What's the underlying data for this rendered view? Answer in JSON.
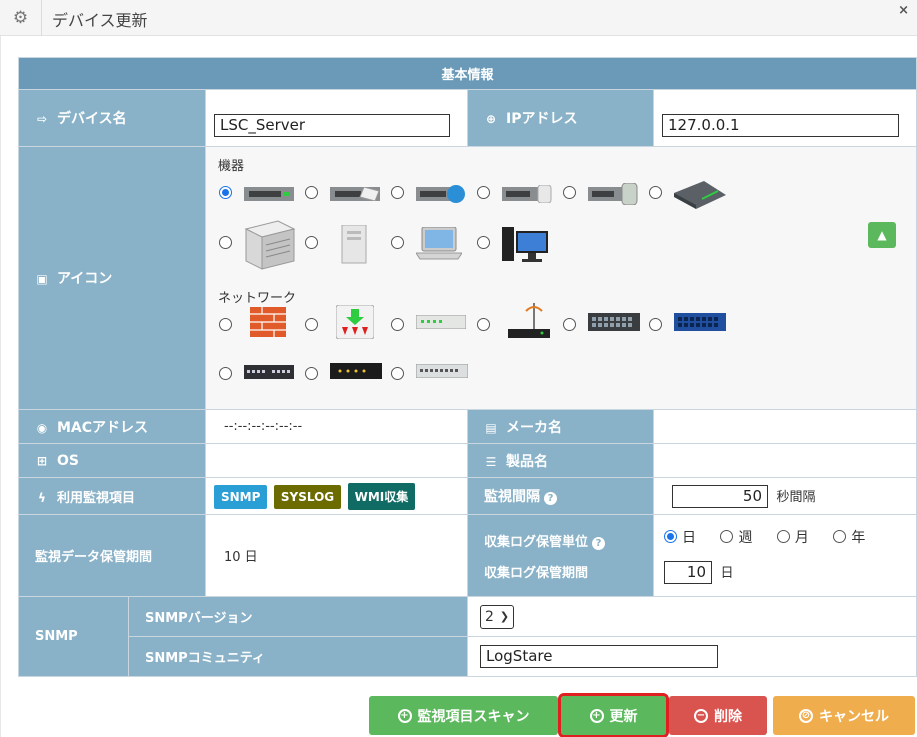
{
  "window": {
    "title": "デバイス更新",
    "close": "×"
  },
  "section_title": "基本情報",
  "device_name": {
    "label": "デバイス名",
    "value": "LSC_Server"
  },
  "ip": {
    "label": "IPアドレス",
    "value": "127.0.0.1"
  },
  "icon": {
    "label": "アイコン",
    "group_equipment": "機器",
    "group_network": "ネットワーク",
    "selected_index": 0
  },
  "mac": {
    "label": "MACアドレス",
    "value": "--:--:--:--:--:--"
  },
  "maker": {
    "label": "メーカ名",
    "value": ""
  },
  "os": {
    "label": "OS",
    "value": ""
  },
  "product": {
    "label": "製品名",
    "value": ""
  },
  "monitoring": {
    "label": "利用監視項目",
    "badges": [
      "SNMP",
      "SYSLOG",
      "WMI収集"
    ],
    "interval_label": "監視間隔",
    "interval_value": "50",
    "interval_unit": "秒間隔"
  },
  "retention": {
    "label": "監視データ保管期間",
    "value": "10 日"
  },
  "log_unit": {
    "label": "収集ログ保管単位",
    "options": [
      "日",
      "週",
      "月",
      "年"
    ],
    "selected": "日",
    "period_label": "収集ログ保管期間",
    "period_value": "10",
    "period_unit": "日"
  },
  "snmp": {
    "label": "SNMP",
    "version_label": "SNMPバージョン",
    "version_value": "2",
    "community_label": "SNMPコミュニティ",
    "community_value": "LogStare"
  },
  "buttons": {
    "scan": "監視項目スキャン",
    "update": "更新",
    "delete": "削除",
    "cancel": "キャンセル"
  },
  "colors": {
    "header": "#6a9ab7",
    "label": "#89b2c8",
    "scan": "#5cb85c",
    "update": "#5cb85c",
    "delete": "#d9534f",
    "cancel": "#f0ad4e",
    "highlight": "#e02020"
  }
}
